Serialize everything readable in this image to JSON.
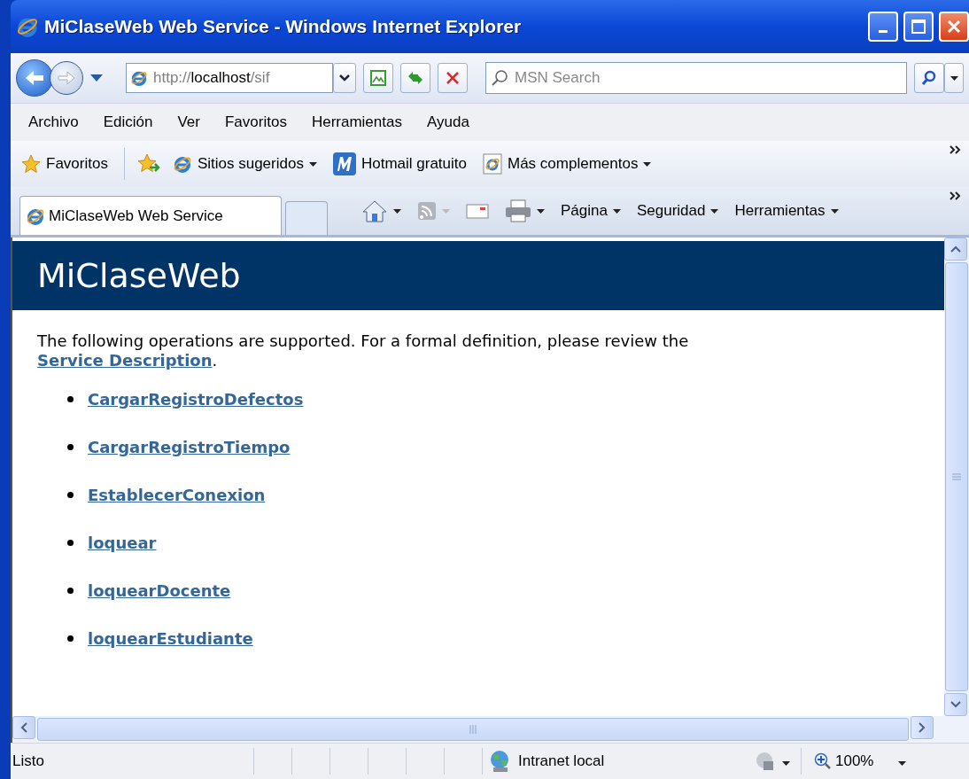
{
  "window": {
    "title": "MiClaseWeb Web Service - Windows Internet Explorer"
  },
  "address": {
    "scheme": "http://",
    "host": "localhost",
    "path": "/sif"
  },
  "search": {
    "placeholder": "MSN Search"
  },
  "menu": [
    "Archivo",
    "Edición",
    "Ver",
    "Favoritos",
    "Herramientas",
    "Ayuda"
  ],
  "favorites_bar": [
    {
      "label": "Favoritos",
      "kind": "star"
    },
    {
      "label": "Sitios sugeridos",
      "kind": "ie-dropdown"
    },
    {
      "label": "Hotmail gratuito",
      "kind": "hotmail"
    },
    {
      "label": "Más complementos",
      "kind": "page-dropdown"
    }
  ],
  "tab": {
    "label": "MiClaseWeb Web Service"
  },
  "command_bar": [
    "Página",
    "Seguridad",
    "Herramientas"
  ],
  "page": {
    "header": "MiClaseWeb",
    "intro": "The following operations are supported. For a formal definition, please review the",
    "intro_link": "Service Description",
    "intro_end": ".",
    "operations": [
      "CargarRegistroDefectos",
      "CargarRegistroTiempo",
      "EstablecerConexion",
      "loquear",
      "loquearDocente",
      "loquearEstudiante"
    ]
  },
  "status_bar": {
    "status": "Listo",
    "zone": "Intranet local",
    "zoom": "100%"
  }
}
